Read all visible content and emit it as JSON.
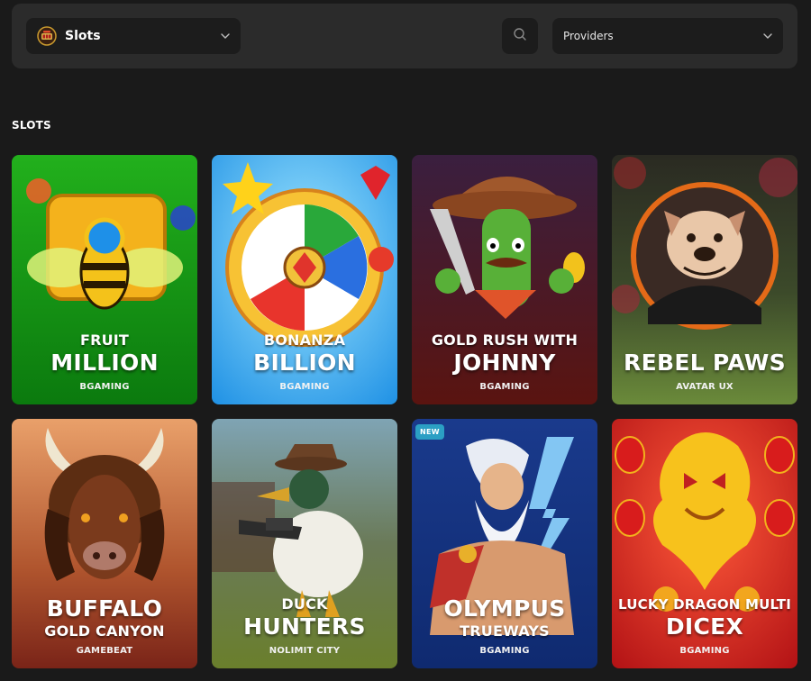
{
  "filters": {
    "category": {
      "label": "Slots",
      "icon": "slot-machine-icon"
    },
    "search": {
      "icon": "search-icon"
    },
    "providers": {
      "label": "Providers"
    }
  },
  "section": {
    "title": "SLOTS"
  },
  "games": [
    {
      "line1": "FRUIT",
      "line2": "MILLION",
      "provider": "BGAMING",
      "badge": "",
      "theme": "bee",
      "colors": [
        "#1fa81a",
        "#0c7a0c"
      ]
    },
    {
      "line1": "BONANZA",
      "line2": "BILLION",
      "provider": "BGAMING",
      "badge": "",
      "theme": "flower",
      "colors": [
        "#34b6f0",
        "#1b8fe0"
      ]
    },
    {
      "line1": "GOLD RUSH WITH",
      "line2": "JOHNNY",
      "provider": "BGAMING",
      "badge": "",
      "theme": "cactus",
      "colors": [
        "#3a1f3a",
        "#5a1818"
      ]
    },
    {
      "line1": "REBEL PAWS",
      "line2": "",
      "provider": "AVATAR UX",
      "badge": "",
      "theme": "bulldog",
      "colors": [
        "#2b3a22",
        "#5c7a36"
      ]
    },
    {
      "line1": "BUFFALO",
      "line2": "GOLD CANYON",
      "provider": "GAMEBEAT",
      "badge": "",
      "theme": "buffalo",
      "colors": [
        "#d08a55",
        "#8a3020"
      ]
    },
    {
      "line1": "DUCK",
      "line2": "HUNTERS",
      "provider": "NOLIMIT CITY",
      "badge": "",
      "theme": "duck",
      "colors": [
        "#6f8fa0",
        "#6a7a34"
      ]
    },
    {
      "line1": "OLYMPUS",
      "line2": "TRUEWAYS",
      "provider": "BGAMING",
      "badge": "NEW",
      "theme": "zeus",
      "colors": [
        "#1d3a8a",
        "#122a6a"
      ]
    },
    {
      "line1": "LUCKY DRAGON MULTI",
      "line2": "DICEX",
      "provider": "BGAMING",
      "badge": "",
      "theme": "dragon",
      "colors": [
        "#e0262b",
        "#b51818"
      ]
    }
  ]
}
